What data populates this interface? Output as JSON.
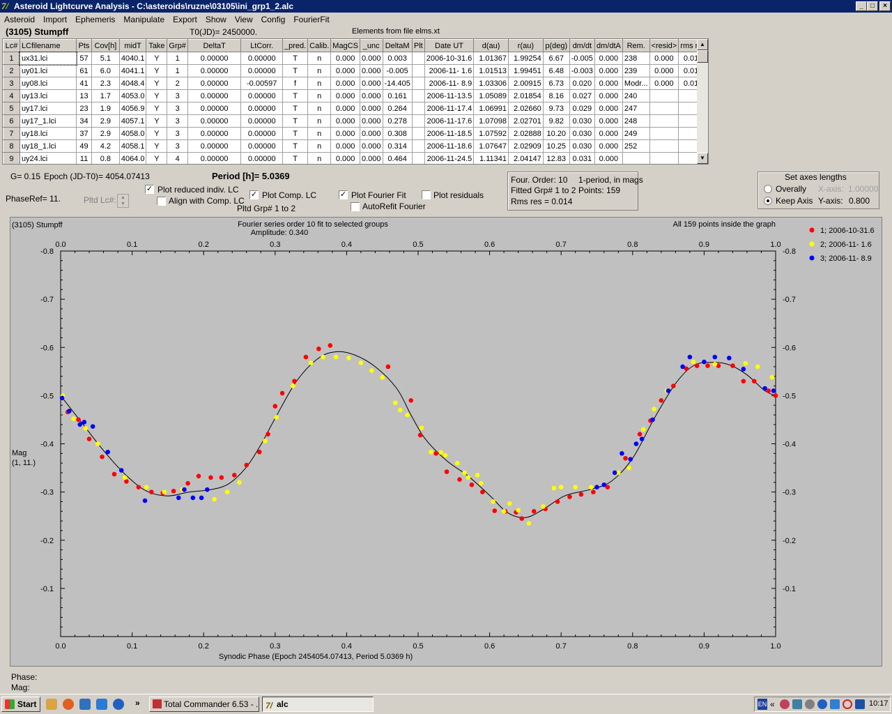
{
  "window": {
    "title": "Asteroid Lightcurve Analysis - C:\\asteroids\\ruzne\\03105\\ini_grp1_2.alc",
    "minimize": "_",
    "maximize": "□",
    "close": "×"
  },
  "menu": [
    "Asteroid",
    "Import",
    "Ephemeris",
    "Manipulate",
    "Export",
    "Show",
    "View",
    "Config",
    "FourierFit"
  ],
  "header": {
    "object": "(3105) Stumpff",
    "t0": "T0(JD)= 2450000.",
    "elements": "Elements from file elms.xt"
  },
  "table": {
    "columns": [
      "Lc#",
      "LCfilename",
      "Pts",
      "Cov[h]",
      "midT",
      "Take",
      "Grp#",
      "DeltaT",
      "LtCorr.",
      "_pred.",
      "Calib.",
      "MagCS",
      "_unc",
      "DeltaM",
      "Plt",
      "Date UT",
      "d(au)",
      "r(au)",
      "p(deg)",
      "dm/dt",
      "dm/dtA",
      "Rem.",
      "<resid>",
      "rms res"
    ],
    "rows": [
      [
        "1",
        "ux31.lci",
        "57",
        "5.1",
        "4040.1",
        "Y",
        "1",
        "0.00000",
        "0.00000",
        "T",
        "n",
        "0.000",
        "0.000",
        "0.003",
        "",
        "2006-10-31.6",
        "1.01367",
        "1.99254",
        "6.67",
        "-0.005",
        "0.000",
        "238",
        "0.000",
        "0.014"
      ],
      [
        "2",
        "uy01.lci",
        "61",
        "6.0",
        "4041.1",
        "Y",
        "1",
        "0.00000",
        "0.00000",
        "T",
        "n",
        "0.000",
        "0.000",
        "-0.005",
        "",
        "2006-11- 1.6",
        "1.01513",
        "1.99451",
        "6.48",
        "-0.003",
        "0.000",
        "239",
        "0.000",
        "0.013"
      ],
      [
        "3",
        "uy08.lci",
        "41",
        "2.3",
        "4048.4",
        "Y",
        "2",
        "0.00000",
        "-0.00597",
        "f",
        "n",
        "0.000",
        "0.000",
        "-14.405",
        "",
        "2006-11- 8.9",
        "1.03306",
        "2.00915",
        "6.73",
        "0.020",
        "0.000",
        "Modr...",
        "0.000",
        "0.010"
      ],
      [
        "4",
        "uy13.lci",
        "13",
        "1.7",
        "4053.0",
        "Y",
        "3",
        "0.00000",
        "0.00000",
        "T",
        "n",
        "0.000",
        "0.000",
        "0.161",
        "",
        "2006-11-13.5",
        "1.05089",
        "2.01854",
        "8.16",
        "0.027",
        "0.000",
        "240",
        "",
        ""
      ],
      [
        "5",
        "uy17.lci",
        "23",
        "1.9",
        "4056.9",
        "Y",
        "3",
        "0.00000",
        "0.00000",
        "T",
        "n",
        "0.000",
        "0.000",
        "0.264",
        "",
        "2006-11-17.4",
        "1.06991",
        "2.02660",
        "9.73",
        "0.029",
        "0.000",
        "247",
        "",
        ""
      ],
      [
        "6",
        "uy17_1.lci",
        "34",
        "2.9",
        "4057.1",
        "Y",
        "3",
        "0.00000",
        "0.00000",
        "T",
        "n",
        "0.000",
        "0.000",
        "0.278",
        "",
        "2006-11-17.6",
        "1.07098",
        "2.02701",
        "9.82",
        "0.030",
        "0.000",
        "248",
        "",
        ""
      ],
      [
        "7",
        "uy18.lci",
        "37",
        "2.9",
        "4058.0",
        "Y",
        "3",
        "0.00000",
        "0.00000",
        "T",
        "n",
        "0.000",
        "0.000",
        "0.308",
        "",
        "2006-11-18.5",
        "1.07592",
        "2.02888",
        "10.20",
        "0.030",
        "0.000",
        "249",
        "",
        ""
      ],
      [
        "8",
        "uy18_1.lci",
        "49",
        "4.2",
        "4058.1",
        "Y",
        "3",
        "0.00000",
        "0.00000",
        "T",
        "n",
        "0.000",
        "0.000",
        "0.314",
        "",
        "2006-11-18.6",
        "1.07647",
        "2.02909",
        "10.25",
        "0.030",
        "0.000",
        "252",
        "",
        ""
      ],
      [
        "9",
        "uy24.lci",
        "11",
        "0.8",
        "4064.0",
        "Y",
        "4",
        "0.00000",
        "0.00000",
        "T",
        "n",
        "0.000",
        "0.000",
        "0.464",
        "",
        "2006-11-24.5",
        "1.11341",
        "2.04147",
        "12.83",
        "0.031",
        "0.000",
        "",
        "",
        ""
      ]
    ]
  },
  "controls": {
    "g": "G= 0.15",
    "epoch": "Epoch (JD-T0)= 4054.07413",
    "period": "Period [h]= 5.0369",
    "phaseref": "PhaseRef= 11.",
    "pltd_lc": "Pltd Lc#:",
    "plot_reduced": "Plot reduced indiv. LC",
    "align_comp": "Align with Comp. LC",
    "plot_comp": "Plot Comp. LC",
    "pltd_grp": "Pltd Grp#  1  to  2",
    "plot_fourier": "Plot Fourier Fit",
    "autorefit": "AutoRefit Fourier",
    "plot_residuals": "Plot residuals",
    "four_order": "Four. Order: 10",
    "fitted_grp": "Fitted Grp# 1 to 2",
    "rms": "Rms res      = 0.014",
    "one_period": "1-period, in mags",
    "points": "Points: 159",
    "axes_title": "Set axes lengths",
    "overally": "Overally",
    "keep_axis": "Keep Axis",
    "xaxis_label": "X-axis:",
    "xaxis_val": "1.00000",
    "yaxis_label": "Y-axis:",
    "yaxis_val": "0.800"
  },
  "chart_data": {
    "type": "scatter",
    "title": "Fourier series order 10 fit to selected groups",
    "subtitle": "Amplitude: 0.340",
    "object": "(3105) Stumpff",
    "note": "All 159 points inside the graph",
    "xlabel": "Synodic Phase (Epoch 2454054.07413, Period 5.0369 h)",
    "ylabel": "Mag",
    "ylabel2": "(1, 11.)",
    "xlim": [
      0,
      1
    ],
    "ylim": [
      0,
      -0.8
    ],
    "xticks": [
      "0.0",
      "0.1",
      "0.2",
      "0.3",
      "0.4",
      "0.5",
      "0.6",
      "0.7",
      "0.8",
      "0.9",
      "1.0"
    ],
    "yticks": [
      "-0.8",
      "-0.7",
      "-0.6",
      "-0.5",
      "-0.4",
      "-0.3",
      "-0.2",
      "-0.1"
    ],
    "grid": false,
    "legend": "top-right",
    "series": [
      {
        "name": "1; 2006-10-31.6",
        "color": "#ff0000",
        "points": [
          [
            0.01,
            -0.466
          ],
          [
            0.025,
            -0.45
          ],
          [
            0.04,
            -0.41
          ],
          [
            0.058,
            -0.373
          ],
          [
            0.075,
            -0.337
          ],
          [
            0.092,
            -0.322
          ],
          [
            0.109,
            -0.31
          ],
          [
            0.127,
            -0.3
          ],
          [
            0.143,
            -0.298
          ],
          [
            0.158,
            -0.302
          ],
          [
            0.178,
            -0.318
          ],
          [
            0.193,
            -0.333
          ],
          [
            0.21,
            -0.33
          ],
          [
            0.225,
            -0.33
          ],
          [
            0.243,
            -0.335
          ],
          [
            0.26,
            -0.356
          ],
          [
            0.278,
            -0.383
          ],
          [
            0.29,
            -0.42
          ],
          [
            0.3,
            -0.478
          ],
          [
            0.31,
            -0.505
          ],
          [
            0.327,
            -0.53
          ],
          [
            0.343,
            -0.58
          ],
          [
            0.361,
            -0.597
          ],
          [
            0.377,
            -0.604
          ],
          [
            0.458,
            -0.56
          ],
          [
            0.49,
            -0.49
          ],
          [
            0.503,
            -0.418
          ],
          [
            0.525,
            -0.38
          ],
          [
            0.54,
            -0.342
          ],
          [
            0.558,
            -0.326
          ],
          [
            0.575,
            -0.315
          ],
          [
            0.59,
            -0.3
          ],
          [
            0.607,
            -0.261
          ],
          [
            0.622,
            -0.26
          ],
          [
            0.637,
            -0.258
          ],
          [
            0.645,
            -0.245
          ],
          [
            0.662,
            -0.26
          ],
          [
            0.678,
            -0.265
          ],
          [
            0.695,
            -0.28
          ],
          [
            0.712,
            -0.29
          ],
          [
            0.728,
            -0.295
          ],
          [
            0.745,
            -0.3
          ],
          [
            0.765,
            -0.31
          ],
          [
            0.79,
            -0.37
          ],
          [
            0.81,
            -0.42
          ],
          [
            0.825,
            -0.448
          ],
          [
            0.84,
            -0.49
          ],
          [
            0.857,
            -0.52
          ],
          [
            0.875,
            -0.556
          ],
          [
            0.89,
            -0.562
          ],
          [
            0.905,
            -0.562
          ],
          [
            0.92,
            -0.562
          ],
          [
            0.94,
            -0.562
          ],
          [
            0.955,
            -0.53
          ],
          [
            0.97,
            -0.53
          ],
          [
            0.99,
            -0.51
          ],
          [
            1.0,
            -0.5
          ]
        ]
      },
      {
        "name": "2; 2006-11- 1.6",
        "color": "#ffff00",
        "points": [
          [
            0.003,
            -0.5
          ],
          [
            0.018,
            -0.452
          ],
          [
            0.035,
            -0.432
          ],
          [
            0.052,
            -0.4
          ],
          [
            0.09,
            -0.33
          ],
          [
            0.12,
            -0.31
          ],
          [
            0.145,
            -0.3
          ],
          [
            0.17,
            -0.305
          ],
          [
            0.215,
            -0.285
          ],
          [
            0.233,
            -0.3
          ],
          [
            0.25,
            -0.32
          ],
          [
            0.286,
            -0.406
          ],
          [
            0.302,
            -0.455
          ],
          [
            0.325,
            -0.52
          ],
          [
            0.35,
            -0.568
          ],
          [
            0.367,
            -0.58
          ],
          [
            0.385,
            -0.58
          ],
          [
            0.403,
            -0.578
          ],
          [
            0.42,
            -0.568
          ],
          [
            0.435,
            -0.552
          ],
          [
            0.45,
            -0.538
          ],
          [
            0.468,
            -0.485
          ],
          [
            0.475,
            -0.47
          ],
          [
            0.485,
            -0.46
          ],
          [
            0.505,
            -0.433
          ],
          [
            0.518,
            -0.383
          ],
          [
            0.532,
            -0.382
          ],
          [
            0.538,
            -0.376
          ],
          [
            0.555,
            -0.36
          ],
          [
            0.565,
            -0.34
          ],
          [
            0.57,
            -0.33
          ],
          [
            0.583,
            -0.335
          ],
          [
            0.588,
            -0.318
          ],
          [
            0.605,
            -0.28
          ],
          [
            0.62,
            -0.26
          ],
          [
            0.628,
            -0.276
          ],
          [
            0.64,
            -0.262
          ],
          [
            0.655,
            -0.235
          ],
          [
            0.675,
            -0.27
          ],
          [
            0.69,
            -0.308
          ],
          [
            0.7,
            -0.31
          ],
          [
            0.72,
            -0.31
          ],
          [
            0.742,
            -0.31
          ],
          [
            0.78,
            -0.34
          ],
          [
            0.795,
            -0.35
          ],
          [
            0.815,
            -0.43
          ],
          [
            0.83,
            -0.472
          ],
          [
            0.848,
            -0.51
          ],
          [
            0.885,
            -0.57
          ],
          [
            0.915,
            -0.565
          ],
          [
            0.958,
            -0.567
          ],
          [
            0.975,
            -0.56
          ],
          [
            0.995,
            -0.538
          ]
        ]
      },
      {
        "name": "3; 2006-11- 8.9",
        "color": "#0000ff",
        "points": [
          [
            0.002,
            -0.495
          ],
          [
            0.012,
            -0.468
          ],
          [
            0.027,
            -0.44
          ],
          [
            0.033,
            -0.445
          ],
          [
            0.045,
            -0.436
          ],
          [
            0.066,
            -0.383
          ],
          [
            0.085,
            -0.345
          ],
          [
            0.118,
            -0.282
          ],
          [
            0.165,
            -0.288
          ],
          [
            0.173,
            -0.305
          ],
          [
            0.185,
            -0.288
          ],
          [
            0.197,
            -0.288
          ],
          [
            0.205,
            -0.305
          ],
          [
            0.75,
            -0.31
          ],
          [
            0.76,
            -0.315
          ],
          [
            0.775,
            -0.34
          ],
          [
            0.785,
            -0.38
          ],
          [
            0.797,
            -0.368
          ],
          [
            0.805,
            -0.4
          ],
          [
            0.813,
            -0.41
          ],
          [
            0.828,
            -0.45
          ],
          [
            0.85,
            -0.51
          ],
          [
            0.87,
            -0.56
          ],
          [
            0.88,
            -0.58
          ],
          [
            0.9,
            -0.57
          ],
          [
            0.915,
            -0.58
          ],
          [
            0.935,
            -0.578
          ],
          [
            0.955,
            -0.555
          ],
          [
            0.985,
            -0.515
          ],
          [
            0.997,
            -0.51
          ]
        ]
      }
    ],
    "fit": [
      [
        0,
        -0.5
      ],
      [
        0.03,
        -0.443
      ],
      [
        0.06,
        -0.386
      ],
      [
        0.09,
        -0.337
      ],
      [
        0.12,
        -0.302
      ],
      [
        0.15,
        -0.292
      ],
      [
        0.18,
        -0.3
      ],
      [
        0.21,
        -0.305
      ],
      [
        0.235,
        -0.317
      ],
      [
        0.26,
        -0.352
      ],
      [
        0.28,
        -0.398
      ],
      [
        0.3,
        -0.453
      ],
      [
        0.33,
        -0.53
      ],
      [
        0.36,
        -0.577
      ],
      [
        0.385,
        -0.591
      ],
      [
        0.41,
        -0.585
      ],
      [
        0.44,
        -0.56
      ],
      [
        0.47,
        -0.515
      ],
      [
        0.49,
        -0.46
      ],
      [
        0.51,
        -0.41
      ],
      [
        0.54,
        -0.365
      ],
      [
        0.57,
        -0.333
      ],
      [
        0.6,
        -0.293
      ],
      [
        0.625,
        -0.257
      ],
      [
        0.65,
        -0.247
      ],
      [
        0.675,
        -0.264
      ],
      [
        0.705,
        -0.292
      ],
      [
        0.74,
        -0.305
      ],
      [
        0.77,
        -0.322
      ],
      [
        0.8,
        -0.37
      ],
      [
        0.83,
        -0.452
      ],
      [
        0.86,
        -0.525
      ],
      [
        0.885,
        -0.562
      ],
      [
        0.91,
        -0.569
      ],
      [
        0.935,
        -0.564
      ],
      [
        0.96,
        -0.543
      ],
      [
        0.985,
        -0.51
      ],
      [
        1.0,
        -0.5
      ]
    ],
    "phase_label": "Phase:",
    "mag_label": "Mag:"
  },
  "taskbar": {
    "start": "Start",
    "more": "»",
    "task1": "Total Commander 6.53 - ...",
    "task2": "alc",
    "lang": "EN",
    "clock": "10:17"
  }
}
